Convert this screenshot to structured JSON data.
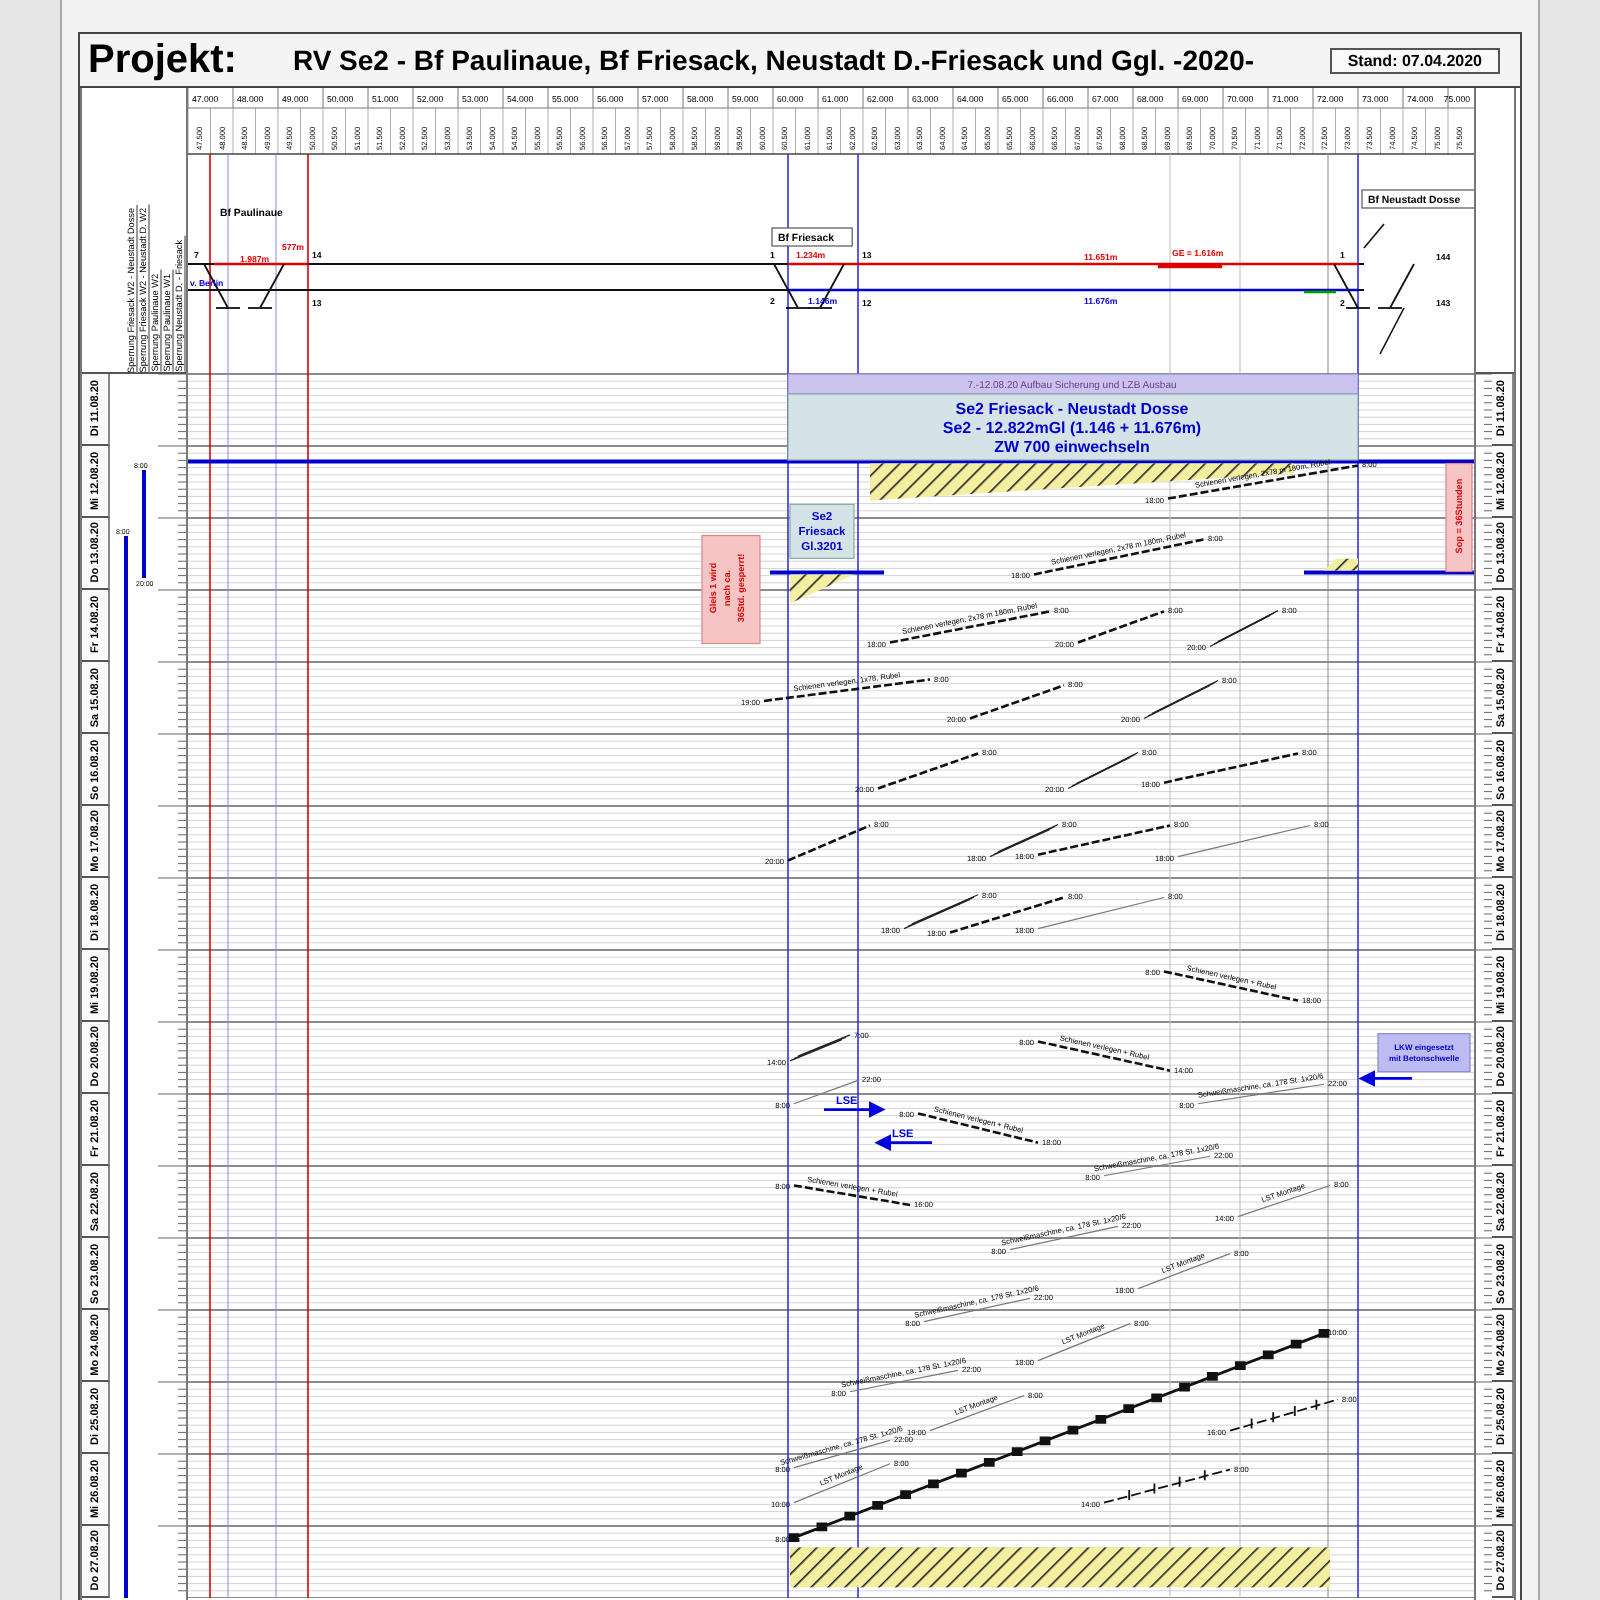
{
  "header": {
    "label": "Projekt:",
    "title": "RV Se2 - Bf Paulinaue, Bf Friesack, Neustadt D.-Friesack und Ggl.  -2020-",
    "stand": "Stand: 07.04.2020"
  },
  "closures": [
    "Sperrung Friesack W2 - Neustadt Dosse",
    "Sperrung Friesack W2 - Neustadt D. W2",
    "Sperrung Paulinaue W2",
    "Sperrung Paulinaue W1",
    "Sperrung Neustadt D. - Friesack"
  ],
  "ruler": {
    "km": [
      "47.000",
      "48.000",
      "49.000",
      "50.000",
      "51.000",
      "52.000",
      "53.000",
      "54.000",
      "55.000",
      "56.000",
      "57.000",
      "58.000",
      "59.000",
      "60.000",
      "61.000",
      "62.000",
      "63.000",
      "64.000",
      "65.000",
      "66.000",
      "67.000",
      "68.000",
      "69.000",
      "70.000",
      "71.000",
      "72.000",
      "73.000",
      "74.000",
      "75.000"
    ],
    "half_km": [
      "47.500",
      "48.000",
      "48.500",
      "49.000",
      "49.500",
      "50.000",
      "50.500",
      "51.000",
      "51.500",
      "52.000",
      "52.500",
      "53.000",
      "53.500",
      "54.000",
      "54.500",
      "55.000",
      "55.500",
      "56.000",
      "56.500",
      "57.000",
      "57.500",
      "58.000",
      "58.500",
      "59.000",
      "59.500",
      "60.000",
      "60.500",
      "61.000",
      "61.500",
      "62.000",
      "62.500",
      "63.000",
      "63.500",
      "64.000",
      "64.500",
      "65.000",
      "65.500",
      "66.000",
      "66.500",
      "67.000",
      "67.500",
      "68.000",
      "68.500",
      "69.000",
      "69.500",
      "70.000",
      "70.500",
      "71.000",
      "71.500",
      "72.000",
      "72.500",
      "73.000",
      "73.500",
      "74.000",
      "74.500",
      "75.000",
      "75.500"
    ]
  },
  "stations": [
    {
      "name": "Bf Paulinaue",
      "boxed": false
    },
    {
      "name": "Bf Friesack",
      "boxed": true
    },
    {
      "name": "Bf Neustadt Dosse",
      "boxed": true
    }
  ],
  "track_labels": [
    {
      "text": "1.987m",
      "color": "#e00000"
    },
    {
      "text": "577m",
      "color": "#e00000"
    },
    {
      "text": "v. Berlin",
      "color": "#0000d0"
    },
    {
      "text": "1.234m",
      "color": "#e00000"
    },
    {
      "text": "11.651m",
      "color": "#e00000"
    },
    {
      "text": "GE = 1.616m",
      "color": "#e00000"
    },
    {
      "text": "1.146m",
      "color": "#0000d0"
    },
    {
      "text": "11.676m",
      "color": "#0000d0"
    }
  ],
  "switch_numbers": [
    "7",
    "14",
    "13",
    "1",
    "2",
    "13",
    "12",
    "1",
    "2",
    "144",
    "143"
  ],
  "days": [
    {
      "left": "Di 11.08.20",
      "right": "Di 11.08.20"
    },
    {
      "left": "Mi 12.08.20",
      "right": "Mi 12.08.20"
    },
    {
      "left": "Do 13.08.20",
      "right": "Do 13.08.20"
    },
    {
      "left": "Fr 14.08.20",
      "right": "Fr 14.08.20"
    },
    {
      "left": "Sa 15.08.20",
      "right": "Sa 15.08.20"
    },
    {
      "left": "So 16.08.20",
      "right": "So 16.08.20"
    },
    {
      "left": "Mo 17.08.20",
      "right": "Mo 17.08.20"
    },
    {
      "left": "Di 18.08.20",
      "right": "Di 18.08.20"
    },
    {
      "left": "Mi 19.08.20",
      "right": "Mi 19.08.20"
    },
    {
      "left": "Do 20.08.20",
      "right": "Do 20.08.20"
    },
    {
      "left": "Fr 21.08.20",
      "right": "Fr 21.08.20"
    },
    {
      "left": "Sa 22.08.20",
      "right": "Sa 22.08.20"
    },
    {
      "left": "So 23.08.20",
      "right": "So 23.08.20"
    },
    {
      "left": "Mo 24.08.20",
      "right": "Mo 24.08.20"
    },
    {
      "left": "Di 25.08.20",
      "right": "Di 25.08.20"
    },
    {
      "left": "Mi 26.08.20",
      "right": "Mi 26.08.20"
    },
    {
      "left": "Do 27.08.20",
      "right": "Do 27.08.20"
    }
  ],
  "closure_bars": [
    {
      "start": "8:00",
      "end": "20:00"
    },
    {
      "start": "8:00"
    }
  ],
  "phase_banner": "7.-12.08.20 Aufbau Sicherung und LZB Ausbau",
  "main_box": [
    "Se2 Friesack - Neustadt Dosse",
    "Se2 - 12.822mGl (1.146 + 11.676m)",
    "ZW 700 einwechseln"
  ],
  "side_box": [
    "Se2",
    "Friesack",
    "Gl.3201"
  ],
  "warning_note": [
    "Gleis 1 wird",
    "nach ca.",
    "36Std. gesperrt!"
  ],
  "sop_note": "Sop = 36Stunden",
  "truck_note": [
    "LKW eingesetzt",
    "mit Betonschwelle"
  ],
  "lse_arrows": [
    {
      "label": "LSE",
      "kind": "right"
    },
    {
      "label": "LSE",
      "kind": "left"
    }
  ],
  "activities": [
    {
      "kind": "work",
      "label": "Schienen verlegen, 2x78 m 180m, Rubel",
      "start": "18:00",
      "end": "8:00"
    },
    {
      "kind": "work",
      "label": "Schienen verlegen, 2x78 m 180m, Rubel",
      "start": "18:00",
      "end": "8:00"
    },
    {
      "kind": "work",
      "label": "Schienen verlegen, 2x78 m 180m, Rubel",
      "start": "18:00",
      "end": "8:00"
    },
    {
      "kind": "work",
      "start": "20:00",
      "end": "8:00"
    },
    {
      "kind": "triple",
      "start": "20:00",
      "end": "8:00"
    },
    {
      "kind": "work",
      "label": "Schienen verlegen, 1x78, Rubel",
      "start": "19:00",
      "end": "8:00"
    },
    {
      "kind": "work",
      "start": "20:00",
      "end": "8:00"
    },
    {
      "kind": "triple",
      "start": "20:00",
      "end": "8:00"
    },
    {
      "kind": "work",
      "start": "20:00",
      "end": "8:00"
    },
    {
      "kind": "triple",
      "start": "20:00",
      "end": "8:00"
    },
    {
      "kind": "work",
      "start": "18:00",
      "end": "8:00"
    },
    {
      "kind": "work",
      "start": "20:00",
      "end": "8:00"
    },
    {
      "kind": "triple",
      "start": "18:00",
      "end": "8:00"
    },
    {
      "kind": "work",
      "start": "18:00",
      "end": "8:00"
    },
    {
      "kind": "plain",
      "start": "18:00",
      "end": "8:00"
    },
    {
      "kind": "triple",
      "start": "18:00",
      "end": "8:00"
    },
    {
      "kind": "work",
      "start": "18:00",
      "end": "8:00"
    },
    {
      "kind": "plain",
      "start": "18:00",
      "end": "8:00"
    },
    {
      "kind": "work",
      "label": "Schienen verlegen + Rubel",
      "start": "8:00",
      "end": "18:00"
    },
    {
      "kind": "triple",
      "start": "14:00",
      "end": "7:00"
    },
    {
      "kind": "work",
      "label": "Schienen verlegen + Rubel",
      "start": "8:00",
      "end": "14:00"
    },
    {
      "kind": "plain",
      "label": "Schweißmaschine, ca. 178 St. 1x20/6",
      "start": "8:00",
      "end": "22:00"
    },
    {
      "kind": "plain",
      "start": "8:00",
      "end": "22:00"
    },
    {
      "kind": "work",
      "label": "Schienen verlegen + Rubel",
      "start": "8:00",
      "end": "18:00"
    },
    {
      "kind": "plain",
      "label": "Schweißmaschine, ca. 178 St. 1x20/6",
      "start": "8:00",
      "end": "22:00"
    },
    {
      "kind": "work",
      "label": "Schienen verlegen + Rubel",
      "start": "8:00",
      "end": "16:00"
    },
    {
      "kind": "plain",
      "label": "LST Montage",
      "start": "14:00",
      "end": "8:00"
    },
    {
      "kind": "plain",
      "label": "Schweißmaschine, ca. 178 St. 1x20/6",
      "start": "8:00",
      "end": "22:00"
    },
    {
      "kind": "plain",
      "label": "LST Montage",
      "start": "18:00",
      "end": "8:00"
    },
    {
      "kind": "plain",
      "label": "Schweißmaschine, ca. 178 St. 1x20/6",
      "start": "8:00",
      "end": "22:00"
    },
    {
      "kind": "plain",
      "label": "LST Montage",
      "start": "18:00",
      "end": "8:00"
    },
    {
      "kind": "plain",
      "label": "Schweißmaschine, ca. 178 St. 1x20/6",
      "start": "8:00",
      "end": "22:00"
    },
    {
      "kind": "plain",
      "label": "LST Montage",
      "start": "19:00",
      "end": "8:00"
    },
    {
      "kind": "segment",
      "start": "16:00",
      "end": "8:00"
    },
    {
      "kind": "plain",
      "label": "Schweißmaschine, ca. 178 St. 1x20/6",
      "start": "8:00",
      "end": "22:00"
    },
    {
      "kind": "plain",
      "label": "LST Montage",
      "start": "10:00",
      "end": "8:00"
    },
    {
      "kind": "segment",
      "start": "14:00",
      "end": "8:00"
    },
    {
      "kind": "chain",
      "start": "8:00",
      "end": "10:00"
    }
  ]
}
